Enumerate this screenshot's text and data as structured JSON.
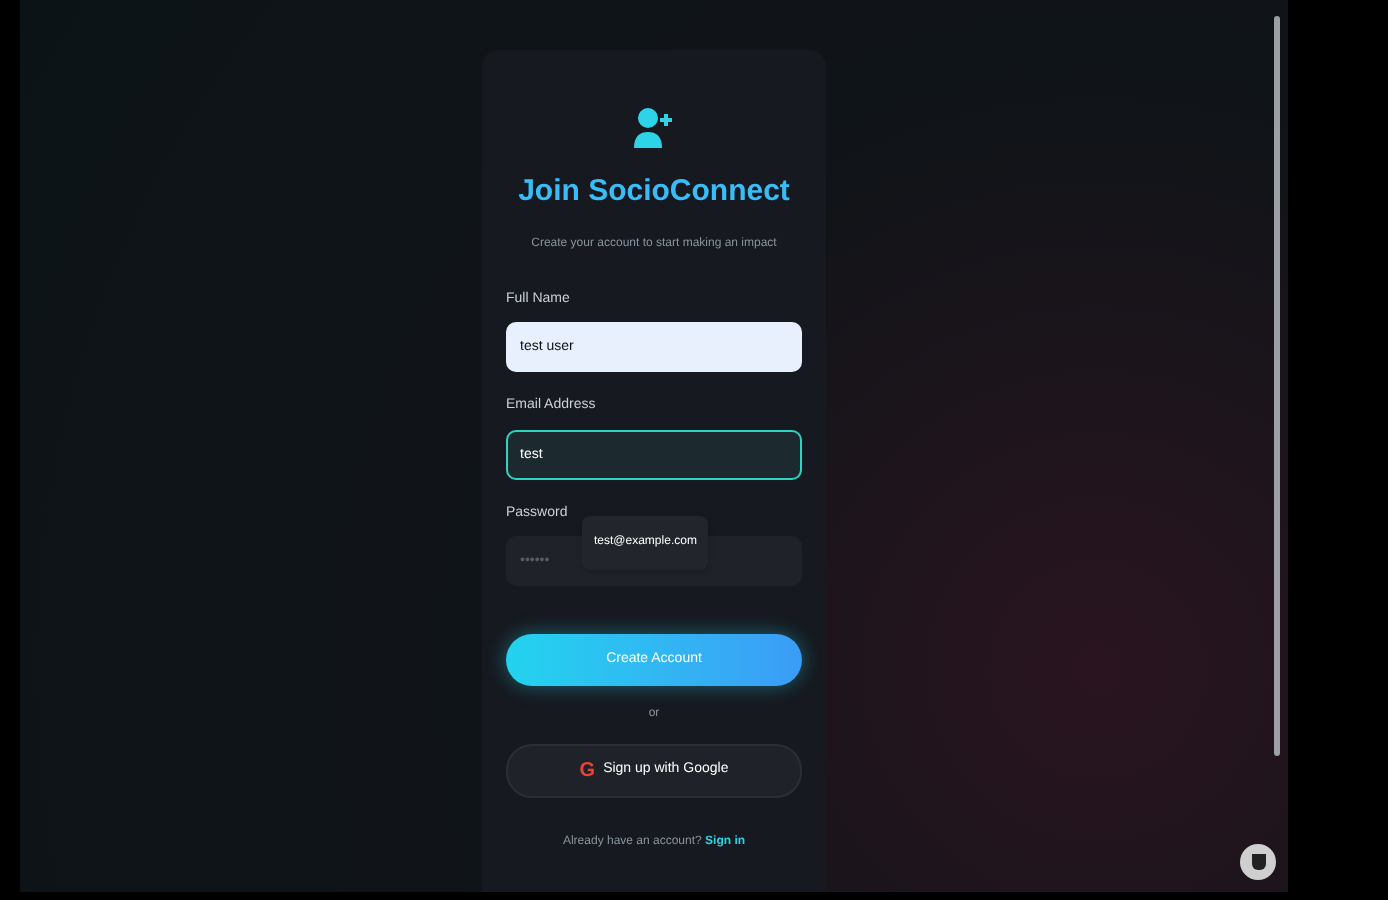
{
  "card": {
    "title": "Join SocioConnect",
    "subtitle": "Create your account to start making an impact"
  },
  "fields": [
    {
      "label": "Full Name",
      "value": "test user",
      "kind": "filled",
      "focused": false
    },
    {
      "label": "Email Address",
      "value": "test",
      "kind": "text",
      "focused": true
    },
    {
      "label": "Password",
      "placeholder": "••••••",
      "kind": "password",
      "focused": false
    }
  ],
  "autocomplete": {
    "suggestion": "test@example.com"
  },
  "primary_button": "Create Account",
  "divider": "or",
  "google_button": {
    "icon": "G",
    "label": "Sign up with Google"
  },
  "footer": {
    "text": "Already have an account?",
    "link": "Sign in"
  }
}
